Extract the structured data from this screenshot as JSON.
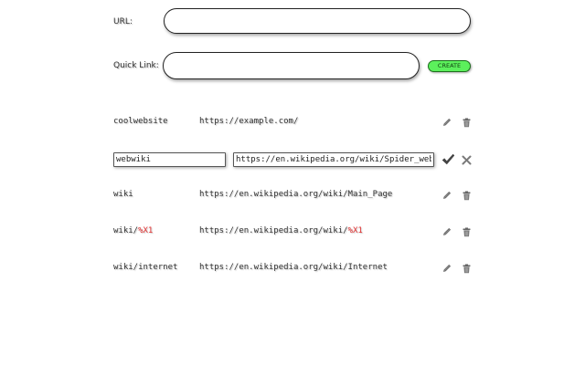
{
  "form": {
    "url_label": "URL:",
    "url_value": "",
    "quick_link_label": "Quick Link:",
    "quick_link_value": "",
    "create_label": "CREATE"
  },
  "links": [
    {
      "name": "coolwebsite",
      "url": "https://example.com/"
    },
    {
      "name": "wiki",
      "url": "https://en.wikipedia.org/wiki/Main_Page"
    },
    {
      "name_prefix": "wiki/",
      "name_placeholder": "%X1",
      "url_prefix": "https://en.wikipedia.org/wiki/",
      "url_placeholder": "%X1"
    },
    {
      "name": "wiki/internet",
      "url": "https://en.wikipedia.org/wiki/Internet"
    }
  ],
  "editing": {
    "name_value": "webwiki",
    "url_value": "https://en.wikipedia.org/wiki/Spider_web"
  },
  "colors": {
    "create_bg": "#5cf05c",
    "placeholder_text": "#e03030"
  },
  "icons": {
    "edit": "pencil-icon",
    "delete": "trash-icon",
    "confirm": "checkmark-icon",
    "cancel": "close-icon"
  }
}
